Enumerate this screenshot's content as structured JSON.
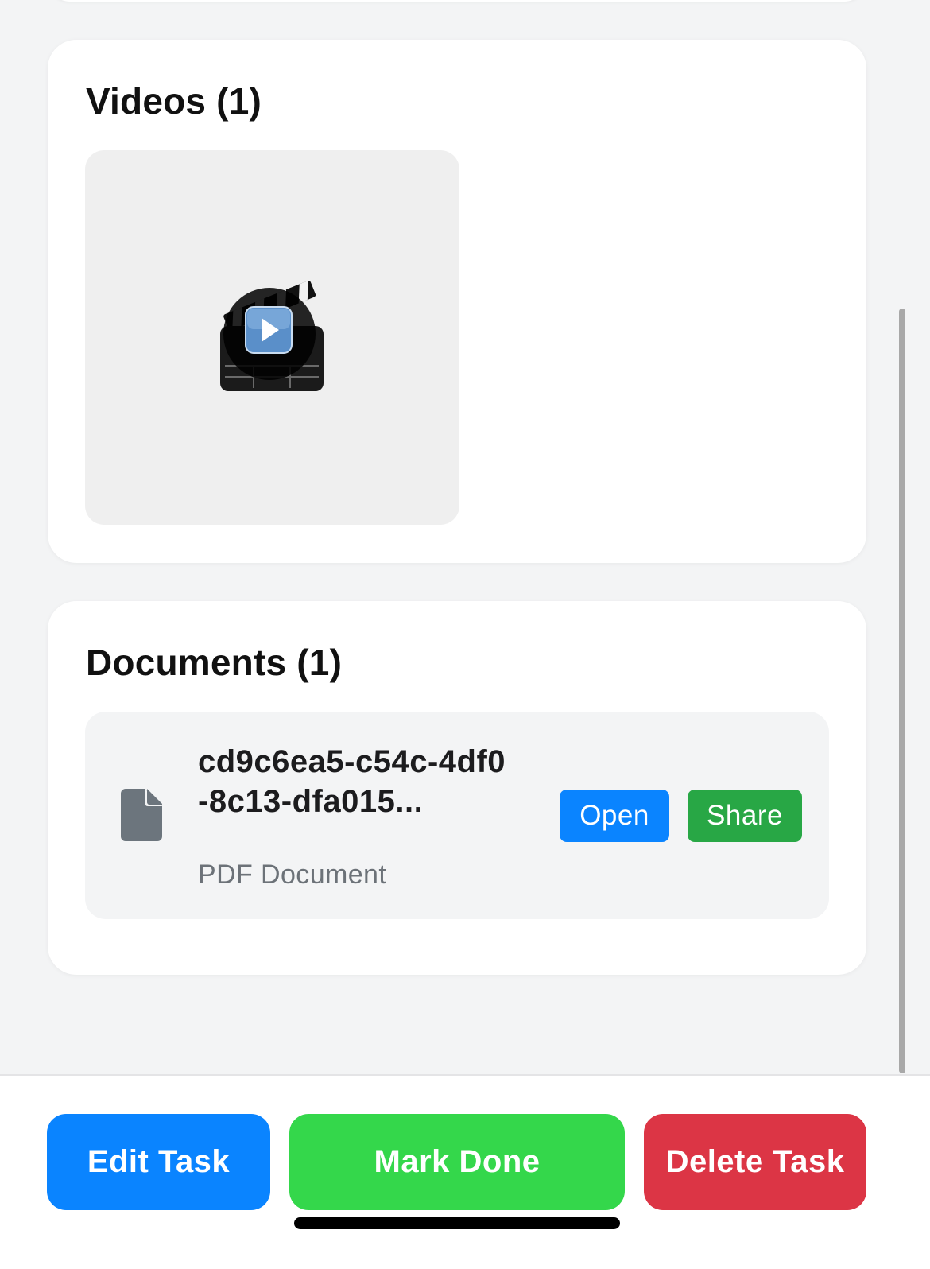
{
  "videos": {
    "title": "Videos (1)",
    "items": [
      {
        "icon": "video-clapperboard-play-icon"
      }
    ]
  },
  "documents": {
    "title": "Documents (1)",
    "items": [
      {
        "icon": "document-file-icon",
        "name": "cd9c6ea5-c54c-4df0-8c13-dfa015...",
        "type": "PDF Document",
        "open_label": "Open",
        "share_label": "Share"
      }
    ]
  },
  "actions": {
    "edit_label": "Edit Task",
    "done_label": "Mark Done",
    "delete_label": "Delete Task"
  },
  "colors": {
    "primary_blue": "#0a84ff",
    "share_green": "#28a745",
    "done_green": "#34d74b",
    "delete_red": "#dc3545",
    "background": "#f3f4f5"
  }
}
